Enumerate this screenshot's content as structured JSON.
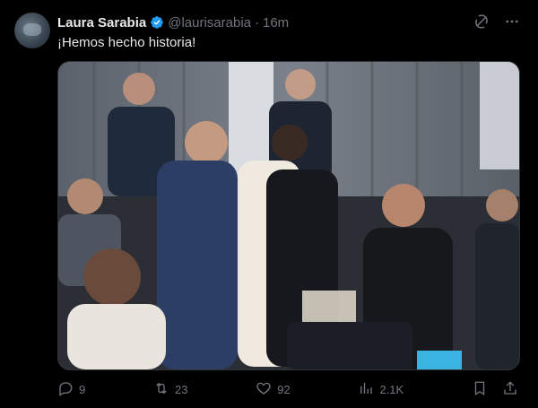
{
  "post": {
    "author_name": "Laura Sarabia",
    "handle": "@laurisarabia",
    "separator": "·",
    "time": "16m",
    "text": "¡Hemos hecho historia!"
  },
  "media": {
    "kind": "photo"
  },
  "actions": {
    "replies": "9",
    "reposts": "23",
    "likes": "92",
    "views": "2.1K"
  },
  "icons": {
    "verified": "verified-badge-icon",
    "grok": "grok-icon",
    "more": "more-icon",
    "reply": "reply-icon",
    "repost": "repost-icon",
    "like": "heart-icon",
    "views": "views-icon",
    "bookmark": "bookmark-icon",
    "share": "share-icon"
  },
  "colors": {
    "background": "#000000",
    "text": "#e7e9ea",
    "muted": "#71767b",
    "verified": "#1d9bf0"
  }
}
